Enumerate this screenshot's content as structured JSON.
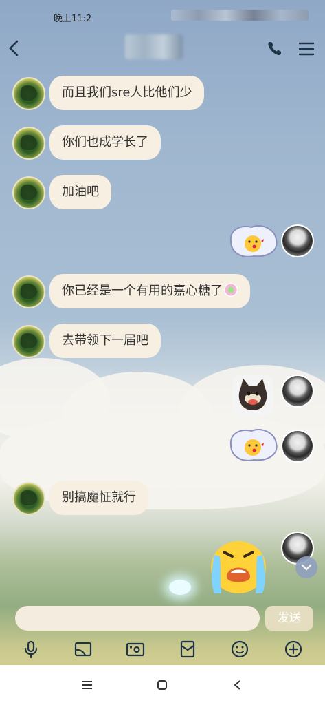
{
  "status": {
    "time": "晚上11:2"
  },
  "header": {
    "back_icon": "chevron-left-icon",
    "call_icon": "phone-icon",
    "menu_icon": "hamburger-menu-icon"
  },
  "messages": [
    {
      "side": "left",
      "type": "text",
      "text": "而且我们sre人比他们少"
    },
    {
      "side": "left",
      "type": "text",
      "text": "你们也成学长了"
    },
    {
      "side": "left",
      "type": "text",
      "text": "加油吧"
    },
    {
      "side": "right",
      "type": "sticker",
      "sticker": "kiss-emoji-sticker"
    },
    {
      "side": "left",
      "type": "text",
      "text": "你已经是一个有用的嘉心糖了"
    },
    {
      "side": "left",
      "type": "text",
      "text": "去带领下一届吧"
    },
    {
      "side": "right",
      "type": "sticker",
      "sticker": "shiba-dog-sticker"
    },
    {
      "side": "right",
      "type": "sticker",
      "sticker": "kiss-emoji-sticker"
    },
    {
      "side": "left",
      "type": "text",
      "text": "别搞魔怔就行"
    },
    {
      "side": "right",
      "type": "sticker",
      "sticker": "crying-emoji-sticker"
    }
  ],
  "composer": {
    "placeholder": "",
    "send_label": "发送"
  },
  "toolbar": [
    "microphone-icon",
    "image-icon",
    "camera-icon",
    "red-packet-icon",
    "emoji-icon",
    "plus-icon"
  ],
  "navbar": [
    "recents-icon",
    "home-icon",
    "back-icon"
  ],
  "colors": {
    "bubble": "#f7efe1",
    "accent": "#1f3346"
  }
}
